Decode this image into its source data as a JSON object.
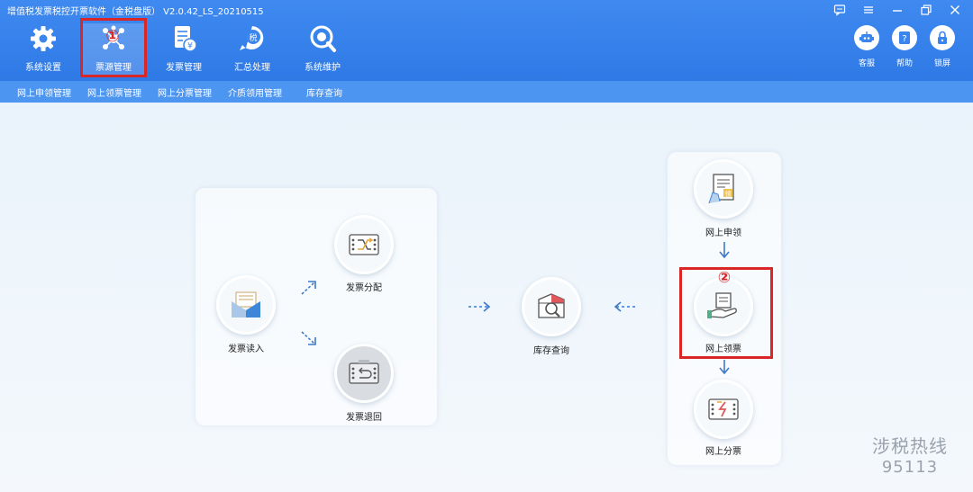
{
  "app": {
    "title": "增值税发票税控开票软件（金税盘版） V2.0.42_LS_20210515"
  },
  "window_controls": [
    {
      "name": "message-icon"
    },
    {
      "name": "menu-icon"
    },
    {
      "name": "minimize-icon"
    },
    {
      "name": "restore-icon"
    },
    {
      "name": "close-icon"
    }
  ],
  "toolbar": {
    "items": [
      {
        "label": "系统设置",
        "icon": "gear-icon"
      },
      {
        "label": "票源管理",
        "icon": "network-icon"
      },
      {
        "label": "发票管理",
        "icon": "invoice-icon"
      },
      {
        "label": "汇总处理",
        "icon": "tax-summary-icon"
      },
      {
        "label": "系统维护",
        "icon": "wrench-icon"
      }
    ],
    "right_items": [
      {
        "label": "客服",
        "icon": "robot-icon"
      },
      {
        "label": "帮助",
        "icon": "help-icon"
      },
      {
        "label": "锁屏",
        "icon": "lock-icon"
      }
    ]
  },
  "subnav": {
    "items": [
      "网上申领管理",
      "网上领票管理",
      "网上分票管理",
      "介质领用管理",
      "库存查询"
    ]
  },
  "annotations": {
    "marker1": "①",
    "marker2": "②",
    "color": "#d92626"
  },
  "flow": {
    "read_in": "发票读入",
    "distribute": "发票分配",
    "return": "发票退回",
    "inventory": "库存查询",
    "apply": "网上申领",
    "receive": "网上领票",
    "split": "网上分票"
  },
  "watermark": {
    "line1": "涉税热线",
    "line2": "95113"
  },
  "colors": {
    "header": "#3a86ee",
    "accent_blue": "#4a8ee0",
    "highlight_red": "#d92626"
  }
}
